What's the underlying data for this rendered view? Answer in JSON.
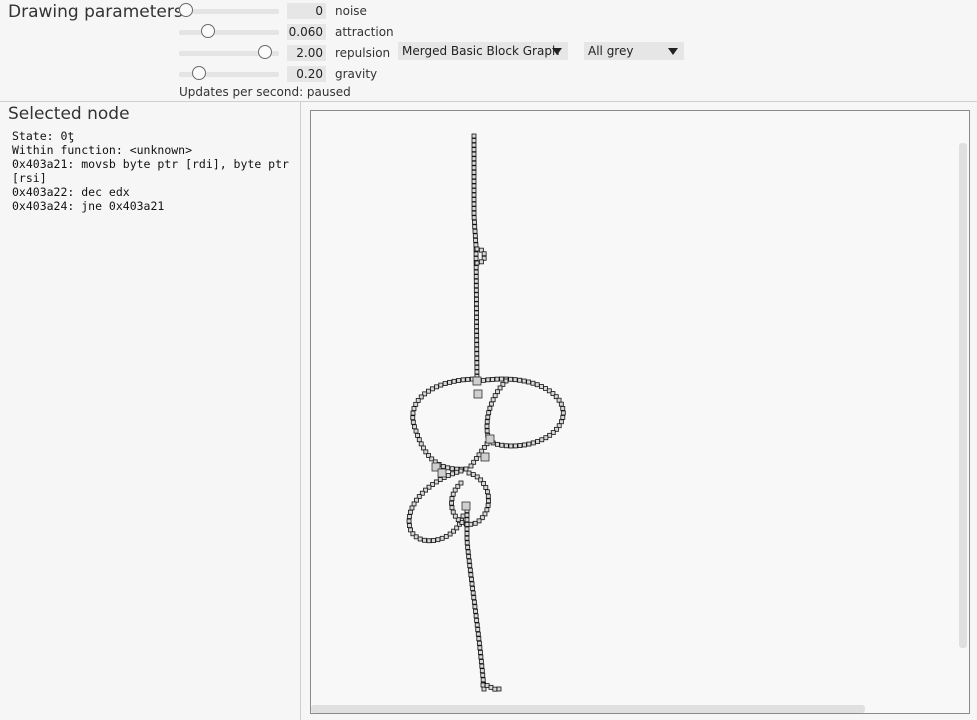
{
  "params": {
    "title": "Drawing parameters",
    "sliders": [
      {
        "name": "noise",
        "value": "0",
        "level": 0.0
      },
      {
        "name": "attraction",
        "value": "0.060",
        "level": 0.26
      },
      {
        "name": "repulsion",
        "value": "2.00",
        "level": 0.92
      },
      {
        "name": "gravity",
        "value": "0.20",
        "level": 0.15
      }
    ],
    "graph_mode": "Merged Basic Block Graph",
    "color_mode": "All grey",
    "updates_per_second": "Updates per second: paused"
  },
  "selected": {
    "title": "Selected node",
    "lines": [
      "State: 0ƫ",
      "Within function: <unknown>",
      "0x403a21: movsb byte ptr [rdi], byte ptr [rsi]",
      "0x403a22: dec edx",
      "0x403a24: jne 0x403a21"
    ]
  },
  "colors": {
    "background": "#f6f6f6",
    "node_fill": "#d8d8d8",
    "edge": "#111111"
  }
}
